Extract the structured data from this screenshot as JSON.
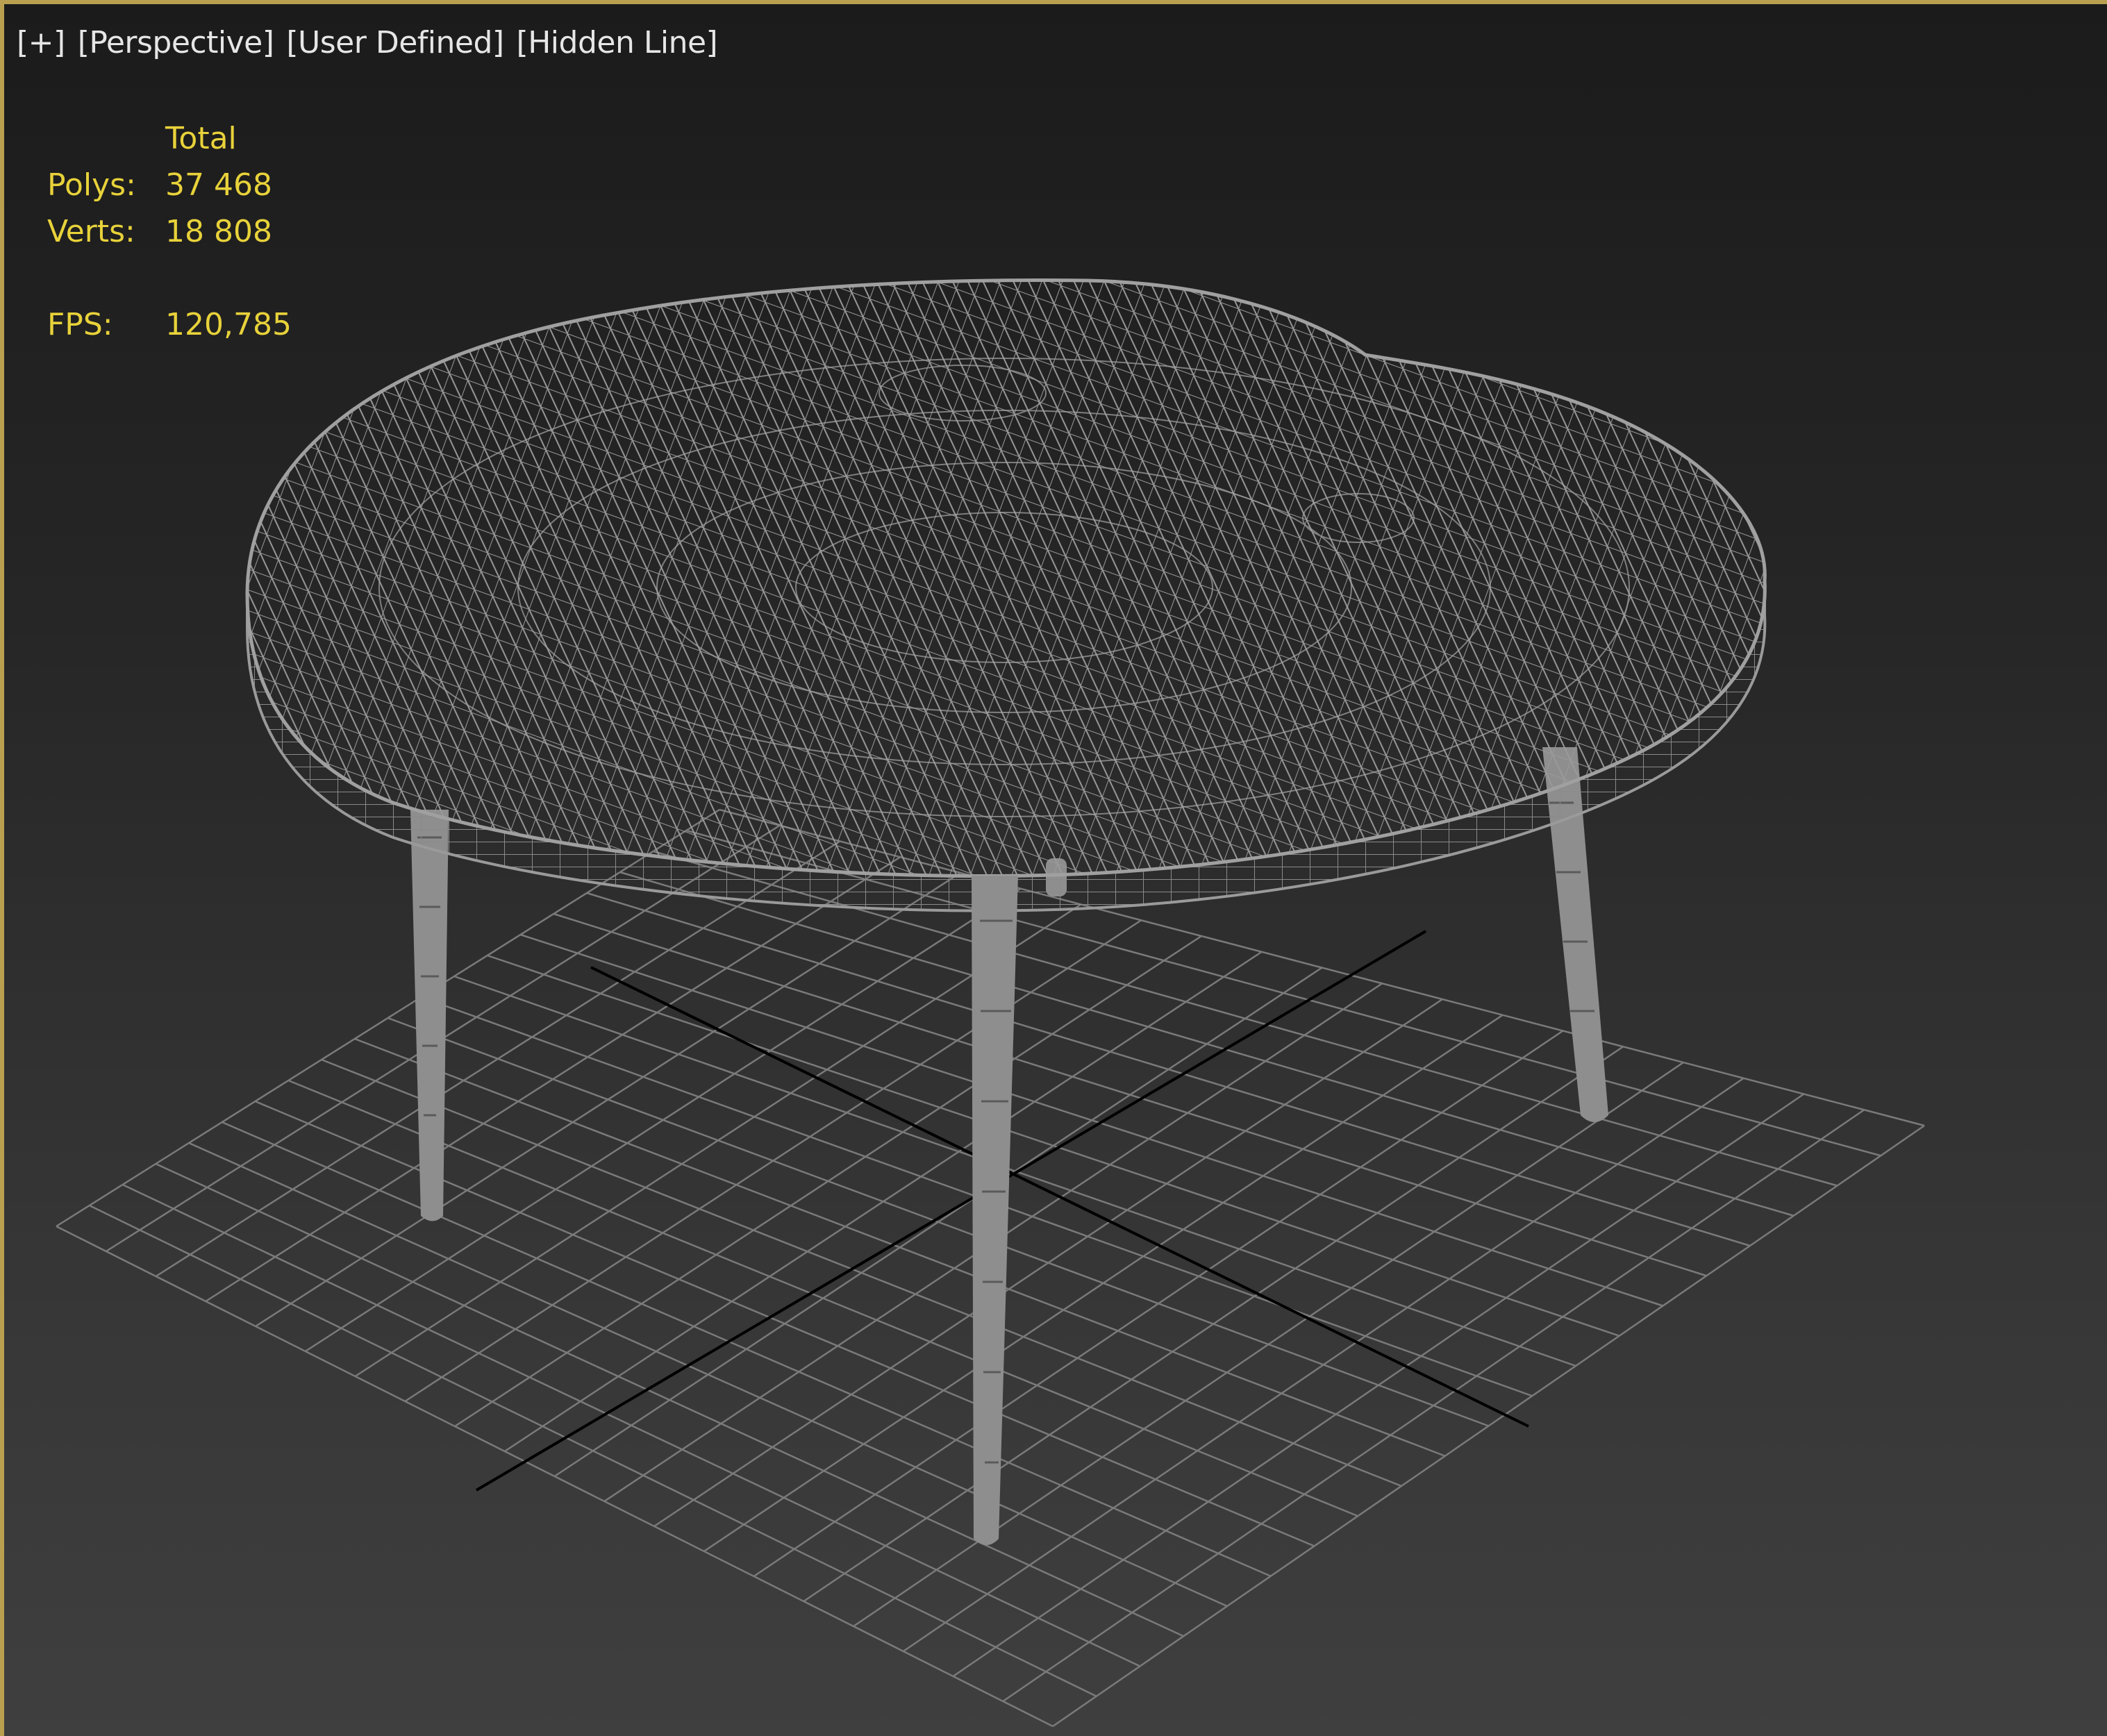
{
  "viewport": {
    "labels": [
      "[+]",
      "[Perspective]",
      "[User Defined]",
      "[Hidden Line]"
    ],
    "border_color": "#b8a050"
  },
  "stats": {
    "header": "Total",
    "polys_label": "Polys:",
    "polys_value": "37 468",
    "verts_label": "Verts:",
    "verts_value": "18 808",
    "fps_label": "FPS:",
    "fps_value": "120,785",
    "text_color": "#e8d23a"
  },
  "scene": {
    "object": "round-table-wireframe",
    "grid_color": "#7a7a7a",
    "axis_color": "#000000",
    "wire_color": "#9a9a9a"
  }
}
